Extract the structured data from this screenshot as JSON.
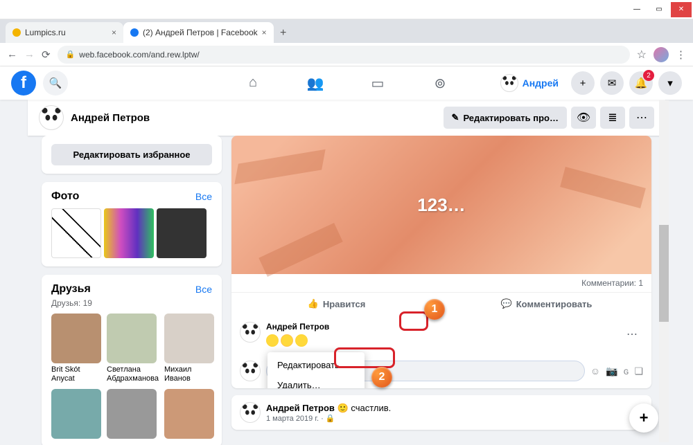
{
  "window": {
    "browser_tabs": [
      {
        "title": "Lumpics.ru",
        "active": false
      },
      {
        "title": "(2) Андрей Петров | Facebook",
        "active": true
      }
    ]
  },
  "addressbar": {
    "url": "web.facebook.com/and.rew.lptw/"
  },
  "fb": {
    "username": "Андрей",
    "notif_count": "2",
    "profile_name": "Андрей Петров",
    "edit_profile_btn": "Редактировать про…"
  },
  "left": {
    "edit_favorites": "Редактировать избранное",
    "photos_title": "Фото",
    "photos_link": "Все",
    "friends_title": "Друзья",
    "friends_link": "Все",
    "friends_count_label": "Друзья: 19",
    "friends": [
      {
        "name": "Brit Skót Anycat"
      },
      {
        "name": "Светлана Абдрахманова"
      },
      {
        "name": "Михаил Иванов"
      },
      {
        "name": ""
      },
      {
        "name": ""
      },
      {
        "name": ""
      }
    ]
  },
  "post1": {
    "image_text": "123…",
    "comments_label": "Комментарии: 1",
    "like": "Нравится",
    "comment": "Комментировать",
    "commenter": "Андрей Петров",
    "menu_edit": "Редактировать…",
    "menu_delete": "Удалить…"
  },
  "post2": {
    "name": "Андрей Петров",
    "feeling": "счастлив.",
    "date": "1 марта 2019 г. · "
  }
}
